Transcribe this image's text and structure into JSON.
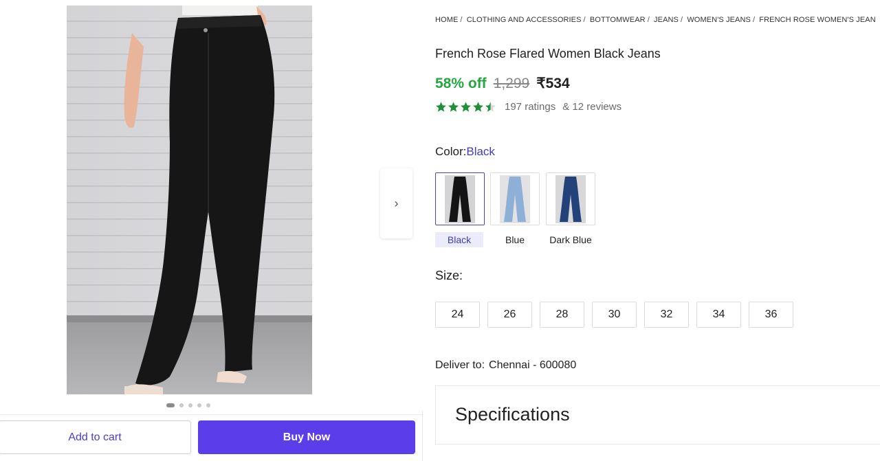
{
  "breadcrumb": [
    {
      "label": "HOME"
    },
    {
      "label": "CLOTHING AND ACCESSORIES"
    },
    {
      "label": "BOTTOMWEAR"
    },
    {
      "label": "JEANS"
    },
    {
      "label": "WOMEN'S JEANS"
    },
    {
      "label": "FRENCH ROSE WOMEN'S JEAN"
    }
  ],
  "product": {
    "title": "French Rose Flared Women Black Jeans",
    "discount": "58% off",
    "mrp": "1,299",
    "price": "₹534",
    "rating_stars": 4.5,
    "ratings_text": "197 ratings",
    "reviews_text": "& 12 reviews"
  },
  "color": {
    "label": "Color:",
    "selected": "Black",
    "options": [
      {
        "name": "Black",
        "shade": "#141414"
      },
      {
        "name": "Blue",
        "shade": "#8fb0d6"
      },
      {
        "name": "Dark Blue",
        "shade": "#23427a"
      }
    ]
  },
  "size": {
    "label": "Size:",
    "options": [
      "24",
      "26",
      "28",
      "30",
      "32",
      "34",
      "36"
    ]
  },
  "delivery": {
    "label": "Deliver to:",
    "location": "Chennai - 600080"
  },
  "gallery": {
    "next_icon": "›",
    "dots_total": 5,
    "dots_active": 1
  },
  "actions": {
    "add_to_cart": "Add to cart",
    "buy_now": "Buy Now"
  },
  "specifications": {
    "title": "Specifications"
  },
  "colors": {
    "accent": "#5b3dea",
    "discount_green": "#26a541",
    "star_green": "#1f8f3a",
    "link_blue": "#3f3db1"
  }
}
